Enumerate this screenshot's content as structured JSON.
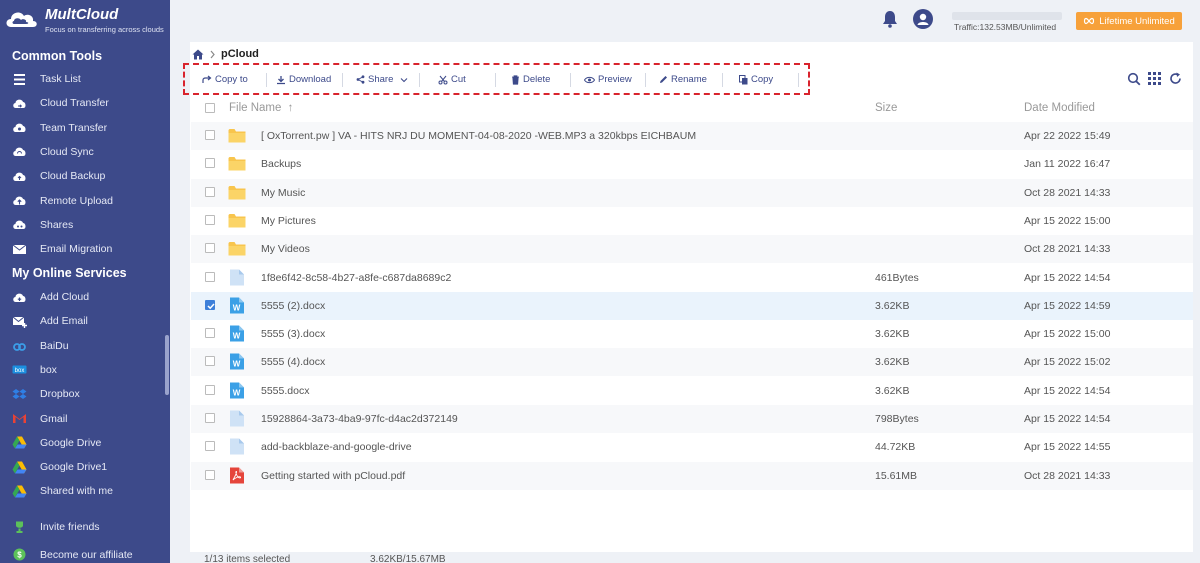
{
  "brand": {
    "name": "MultCloud",
    "tagline": "Focus on transferring across clouds"
  },
  "sidebar": {
    "common_title": "Common Tools",
    "common_items": [
      {
        "label": "Task List",
        "icon": "task-list-icon"
      },
      {
        "label": "Cloud Transfer",
        "icon": "cloud-transfer-icon"
      },
      {
        "label": "Team Transfer",
        "icon": "team-transfer-icon"
      },
      {
        "label": "Cloud Sync",
        "icon": "cloud-sync-icon"
      },
      {
        "label": "Cloud Backup",
        "icon": "cloud-backup-icon"
      },
      {
        "label": "Remote Upload",
        "icon": "remote-upload-icon"
      },
      {
        "label": "Shares",
        "icon": "shares-icon"
      },
      {
        "label": "Email Migration",
        "icon": "email-migration-icon"
      }
    ],
    "services_title": "My Online Services",
    "service_items": [
      {
        "label": "Add Cloud",
        "icon": "add-cloud-icon"
      },
      {
        "label": "Add Email",
        "icon": "add-email-icon"
      },
      {
        "label": "BaiDu",
        "icon": "baidu-icon"
      },
      {
        "label": "box",
        "icon": "box-icon"
      },
      {
        "label": "Dropbox",
        "icon": "dropbox-icon"
      },
      {
        "label": "Gmail",
        "icon": "gmail-icon"
      },
      {
        "label": "Google Drive",
        "icon": "google-drive-icon"
      },
      {
        "label": "Google Drive1",
        "icon": "google-drive-icon"
      },
      {
        "label": "Shared with me",
        "icon": "google-drive-icon"
      }
    ],
    "bottom_items": [
      {
        "label": "Invite friends",
        "icon": "trophy-icon"
      },
      {
        "label": "Become our affiliate",
        "icon": "dollar-icon"
      }
    ]
  },
  "topbar": {
    "traffic": "Traffic:132.53MB/Unlimited",
    "lifetime": "Lifetime Unlimited"
  },
  "breadcrumb": {
    "current": "pCloud"
  },
  "toolbar": {
    "copy_to": "Copy to",
    "download": "Download",
    "share": "Share",
    "cut": "Cut",
    "delete": "Delete",
    "preview": "Preview",
    "rename": "Rename",
    "copy": "Copy"
  },
  "table": {
    "col_name": "File Name",
    "col_size": "Size",
    "col_date": "Date Modified",
    "rows": [
      {
        "type": "folder",
        "name": "[ OxTorrent.pw ] VA - HITS NRJ DU MOMENT-04-08-2020 -WEB.MP3 a 320kbps EICHBAUM",
        "size": "",
        "date": "Apr 22 2022 15:49",
        "checked": false
      },
      {
        "type": "folder",
        "name": "Backups",
        "size": "",
        "date": "Jan 11 2022 16:47",
        "checked": false
      },
      {
        "type": "folder",
        "name": "My Music",
        "size": "",
        "date": "Oct 28 2021 14:33",
        "checked": false
      },
      {
        "type": "folder",
        "name": "My Pictures",
        "size": "",
        "date": "Apr 15 2022 15:00",
        "checked": false
      },
      {
        "type": "folder",
        "name": "My Videos",
        "size": "",
        "date": "Oct 28 2021 14:33",
        "checked": false
      },
      {
        "type": "file",
        "name": "1f8e6f42-8c58-4b27-a8fe-c687da8689c2",
        "size": "461Bytes",
        "date": "Apr 15 2022 14:54",
        "checked": false
      },
      {
        "type": "word",
        "name": "5555 (2).docx",
        "size": "3.62KB",
        "date": "Apr 15 2022 14:59",
        "checked": true
      },
      {
        "type": "word",
        "name": "5555 (3).docx",
        "size": "3.62KB",
        "date": "Apr 15 2022 15:00",
        "checked": false
      },
      {
        "type": "word",
        "name": "5555 (4).docx",
        "size": "3.62KB",
        "date": "Apr 15 2022 15:02",
        "checked": false
      },
      {
        "type": "word",
        "name": "5555.docx",
        "size": "3.62KB",
        "date": "Apr 15 2022 14:54",
        "checked": false
      },
      {
        "type": "file",
        "name": "15928864-3a73-4ba9-97fc-d4ac2d372149",
        "size": "798Bytes",
        "date": "Apr 15 2022 14:54",
        "checked": false
      },
      {
        "type": "file",
        "name": "add-backblaze-and-google-drive",
        "size": "44.72KB",
        "date": "Apr 15 2022 14:55",
        "checked": false
      },
      {
        "type": "pdf",
        "name": "Getting started with pCloud.pdf",
        "size": "15.61MB",
        "date": "Oct 28 2021 14:33",
        "checked": false
      }
    ]
  },
  "footer": {
    "selected": "1/13 items selected",
    "size": "3.62KB/15.67MB"
  },
  "colors": {
    "sidebar": "#3d4a8a",
    "accent": "#f7a13a",
    "highlight": "#d9232d",
    "folder": "#f8c54d",
    "word": "#3ba0e6",
    "pdf": "#e5453b"
  }
}
